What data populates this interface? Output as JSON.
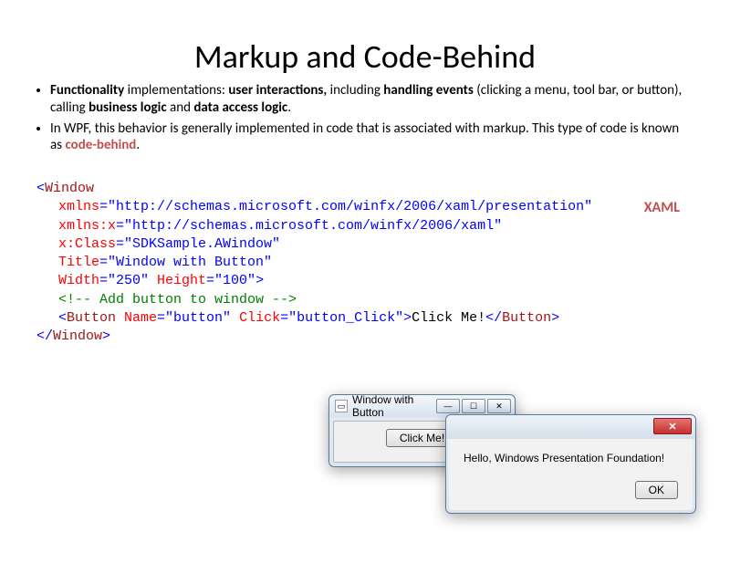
{
  "title": "Markup and Code-Behind",
  "bullets": {
    "b1": {
      "p1": "Functionality",
      "p2": " implementations: ",
      "p3": "user interactions,",
      "p4": " including ",
      "p5": "handling events",
      "p6": " (clicking a menu, tool bar, or button),  calling ",
      "p7": "business logic",
      "p8": " and ",
      "p9": "data access logic",
      "p10": "."
    },
    "b2": {
      "p1": "In WPF, this behavior is generally implemented in code that is associated with markup. This type of code is known as ",
      "p2": "code-behind",
      "p3": "."
    }
  },
  "xaml_label": "XAML",
  "code": {
    "l1_open": "<",
    "l1_tag": "Window",
    "l2_attr": "xmlns",
    "l2_eq": "=\"http://schemas.microsoft.com/winfx/2006/xaml/presentation\"",
    "l3_attr": "xmlns:x",
    "l3_eq": "=\"http://schemas.microsoft.com/winfx/2006/xaml\"",
    "l4_attr": "x:Class",
    "l4_eq": "=\"SDKSample.AWindow\"",
    "l5_attr": "Title",
    "l5_eq": "=\"Window with Button\"",
    "l6_attr1": "Width",
    "l6_eq1": "=\"250\" ",
    "l6_attr2": "Height",
    "l6_eq2": "=\"100\"",
    "l6_close": ">",
    "l7_comment": "<!-- Add button to window -->",
    "l8_open": "<",
    "l8_tag": "Button ",
    "l8_attr1": "Name",
    "l8_eq1": "=\"button\" ",
    "l8_attr2": "Click",
    "l8_eq2": "=\"button_Click\"",
    "l8_close1": ">",
    "l8_text": "Click Me!",
    "l8_close2": "</",
    "l8_tag2": "Button",
    "l8_close3": ">",
    "l9_open": "</",
    "l9_tag": "Window",
    "l9_close": ">"
  },
  "win_a": {
    "title": "Window with Button",
    "button": "Click Me!",
    "min": "—",
    "max": "☐",
    "close": "✕"
  },
  "win_b": {
    "message": "Hello, Windows Presentation Foundation!",
    "ok": "OK",
    "close": "✕"
  }
}
